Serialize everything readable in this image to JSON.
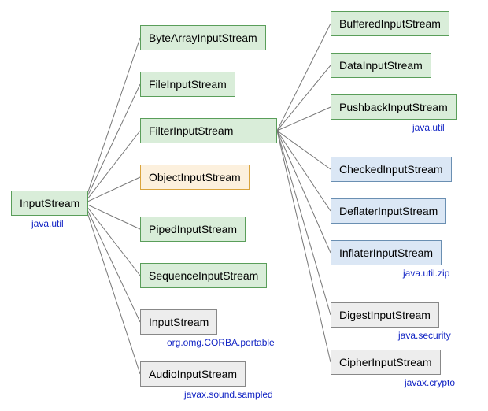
{
  "root": {
    "label": "InputStream",
    "package": "java.util"
  },
  "level2": [
    {
      "label": "ByteArrayInputStream"
    },
    {
      "label": "FileInputStream"
    },
    {
      "label": "FilterInputStream"
    },
    {
      "label": "ObjectInputStream"
    },
    {
      "label": "PipedInputStream"
    },
    {
      "label": "SequenceInputStream"
    },
    {
      "label": "InputStream",
      "package": "org.omg.CORBA.portable"
    },
    {
      "label": "AudioInputStream",
      "package": "javax.sound.sampled"
    }
  ],
  "level3": [
    {
      "label": "BufferedInputStream"
    },
    {
      "label": "DataInputStream"
    },
    {
      "label": "PushbackInputStream",
      "package": "java.util"
    },
    {
      "label": "CheckedInputStream"
    },
    {
      "label": "DeflaterInputStream"
    },
    {
      "label": "InflaterInputStream",
      "package": "java.util.zip"
    },
    {
      "label": "DigestInputStream",
      "package": "java.security"
    },
    {
      "label": "CipherInputStream",
      "package": "javax.crypto"
    }
  ]
}
